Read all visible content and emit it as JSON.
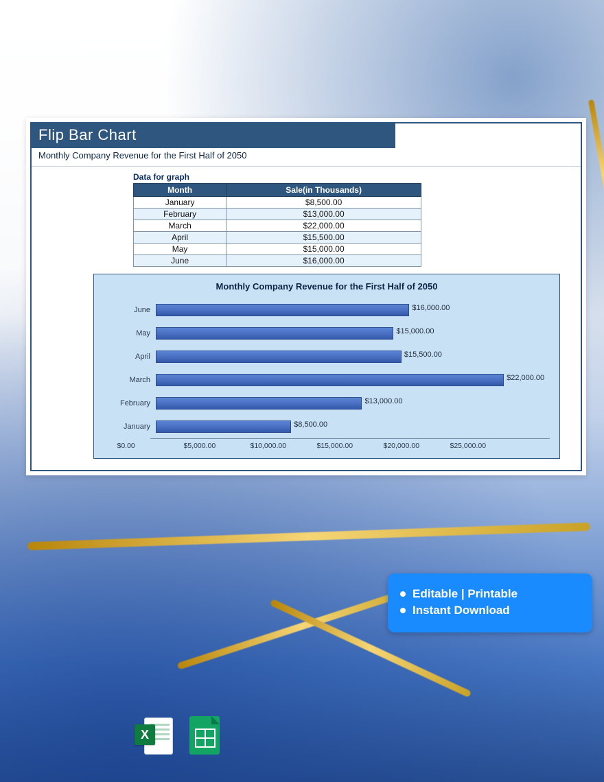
{
  "card": {
    "title": "Flip Bar Chart",
    "subtitle": "Monthly Company Revenue for the First Half of 2050",
    "table_label": "Data for graph",
    "table_headers": {
      "month": "Month",
      "sale": "Sale(in Thousands)"
    },
    "table_rows": [
      {
        "month": "January",
        "sale": "$8,500.00"
      },
      {
        "month": "February",
        "sale": "$13,000.00"
      },
      {
        "month": "March",
        "sale": "$22,000.00"
      },
      {
        "month": "April",
        "sale": "$15,500.00"
      },
      {
        "month": "May",
        "sale": "$15,000.00"
      },
      {
        "month": "June",
        "sale": "$16,000.00"
      }
    ]
  },
  "chart_data": {
    "type": "bar",
    "orientation": "horizontal",
    "title": "Monthly Company Revenue for the First Half of 2050",
    "categories": [
      "June",
      "May",
      "April",
      "March",
      "February",
      "January"
    ],
    "values": [
      16000,
      15000,
      15500,
      22000,
      13000,
      8500
    ],
    "value_labels": [
      "$16,000.00",
      "$15,000.00",
      "$15,500.00",
      "$22,000.00",
      "$13,000.00",
      "$8,500.00"
    ],
    "xlabel": "",
    "ylabel": "",
    "xlim": [
      0,
      25000
    ],
    "x_ticks": [
      "$0.00",
      "$5,000.00",
      "$10,000.00",
      "$15,000.00",
      "$20,000.00",
      "$25,000.00"
    ],
    "bar_color": "#4169c8"
  },
  "features": {
    "line1": "Editable | Printable",
    "line2": "Instant Download"
  },
  "file_formats": {
    "excel_badge": "X",
    "sheets": "Sheets"
  }
}
